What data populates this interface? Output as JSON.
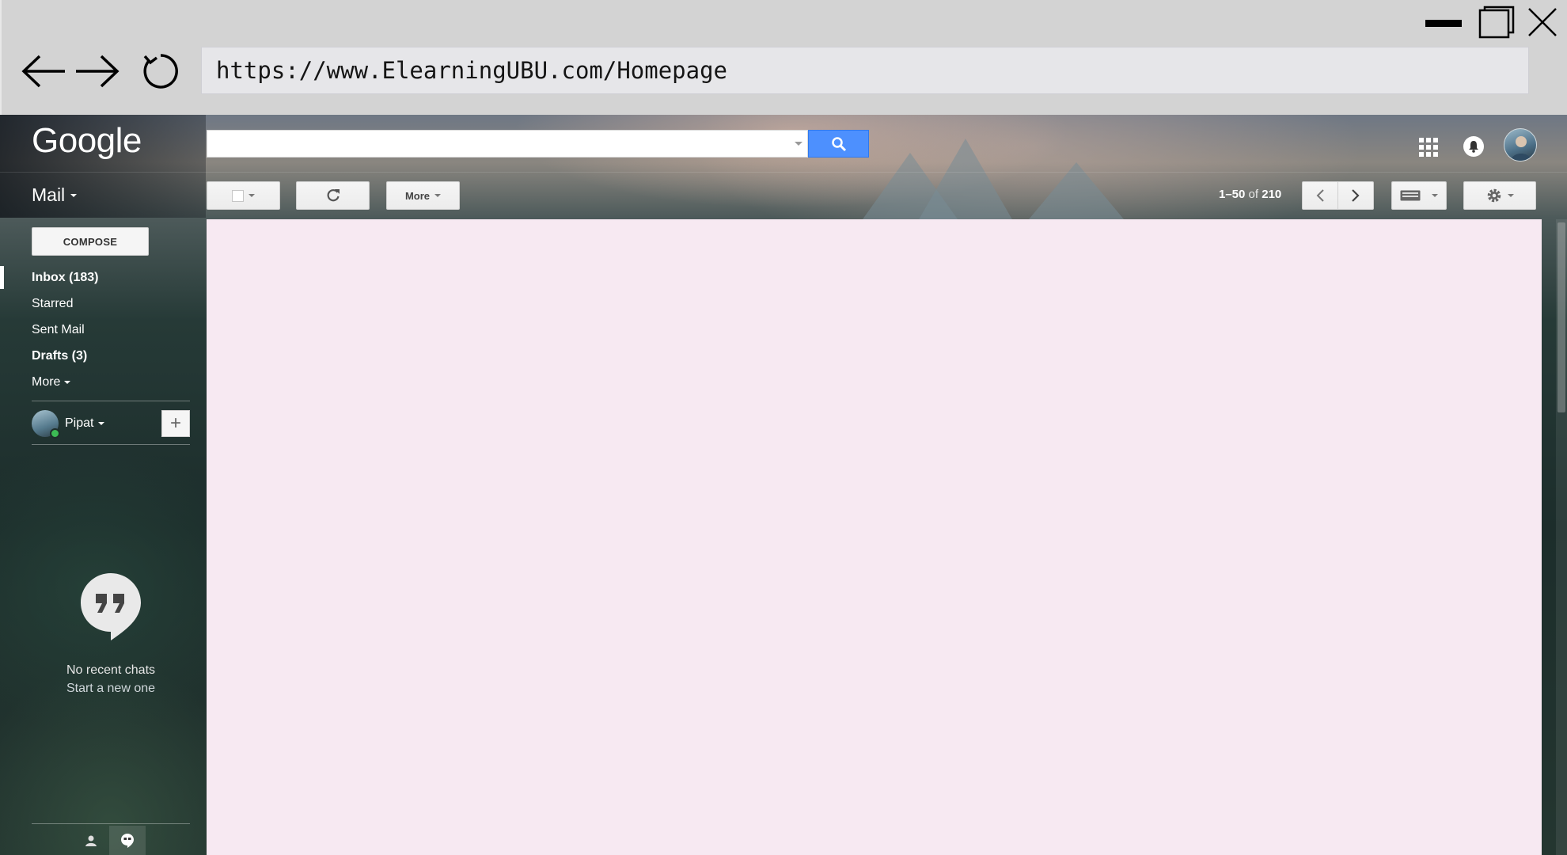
{
  "browser": {
    "url": "https://www.ElearningUBU.com/Homepage"
  },
  "gmail": {
    "logo_text": "Google",
    "mail_label": "Mail",
    "toolbar": {
      "more_label": "More",
      "pager_range": "1–50",
      "pager_of": "of",
      "pager_total": "210"
    },
    "compose_label": "COMPOSE",
    "nav": {
      "inbox": "Inbox (183)",
      "starred": "Starred",
      "sent": "Sent Mail",
      "drafts": "Drafts (3)",
      "more": "More"
    },
    "user": {
      "name": "Pipat"
    },
    "chat": {
      "empty_line1": "No recent chats",
      "empty_line2": "Start a new one"
    }
  },
  "colors": {
    "search_button": "#4d90fe",
    "content_background": "#f7e9f2",
    "online_status": "#3cba54"
  },
  "icons": {
    "window": [
      "minimize-icon",
      "maximize-icon",
      "close-icon"
    ],
    "navigation": [
      "back-arrow-icon",
      "forward-arrow-icon",
      "reload-icon"
    ],
    "header": [
      "search-icon",
      "apps-grid-icon",
      "notification-bell-icon",
      "account-avatar"
    ],
    "toolbar": [
      "checkbox-icon",
      "refresh-icon",
      "chevron-left-icon",
      "chevron-right-icon",
      "keyboard-icon",
      "gear-icon"
    ],
    "sidebar": [
      "plus-icon",
      "hangouts-quote-icon",
      "person-icon",
      "hangouts-icon"
    ]
  }
}
